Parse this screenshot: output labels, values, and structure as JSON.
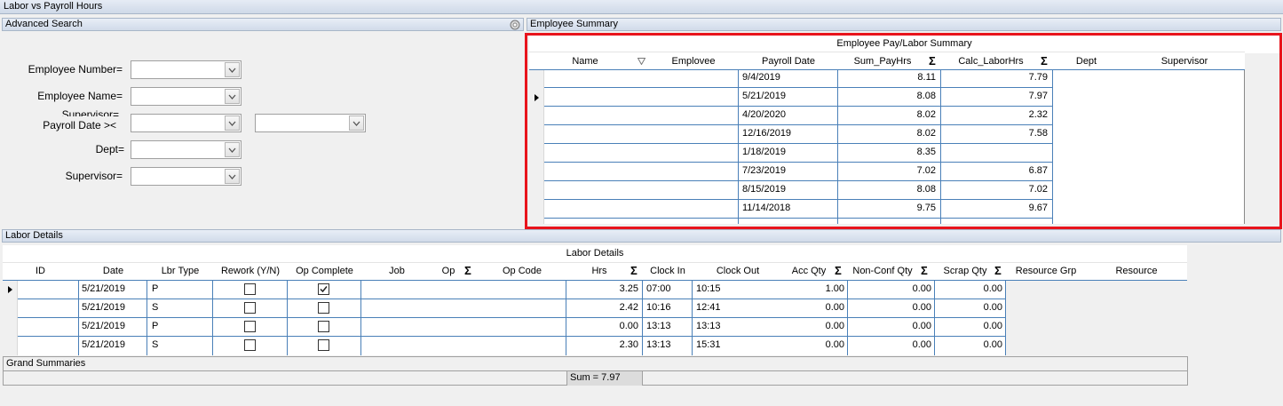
{
  "window": {
    "title": "Labor vs Payroll Hours"
  },
  "search_panel": {
    "title": "Advanced Search",
    "fields": [
      {
        "label": "Employee Number=",
        "value": ""
      },
      {
        "label": "Employee Name=",
        "value": ""
      },
      {
        "label_top": "Supervisor=",
        "label": "Payroll Date ><",
        "value": "",
        "value2": ""
      },
      {
        "label": "Dept=",
        "value": ""
      },
      {
        "label": "Supervisor=",
        "value": ""
      }
    ]
  },
  "employee_summary": {
    "panel_title": "Employee Summary",
    "grid_title": "Employee Pay/Labor Summary",
    "columns": [
      "Name",
      "Emplovee",
      "Payroll Date",
      "Sum_PayHrs",
      "Calc_LaborHrs",
      "Dept",
      "Supervisor"
    ],
    "rows": [
      {
        "date": "9/4/2019",
        "pay": "8.11",
        "labor": "7.79"
      },
      {
        "date": "5/21/2019",
        "pay": "8.08",
        "labor": "7.97"
      },
      {
        "date": "4/20/2020",
        "pay": "8.02",
        "labor": "2.32"
      },
      {
        "date": "12/16/2019",
        "pay": "8.02",
        "labor": "7.58"
      },
      {
        "date": "1/18/2019",
        "pay": "8.35",
        "labor": ""
      },
      {
        "date": "7/23/2019",
        "pay": "7.02",
        "labor": "6.87"
      },
      {
        "date": "8/15/2019",
        "pay": "8.08",
        "labor": "7.02"
      },
      {
        "date": "11/14/2018",
        "pay": "9.75",
        "labor": "9.67"
      }
    ],
    "highlight_color": "#e8141c"
  },
  "labor_details": {
    "panel_title": "Labor Details",
    "grid_title": "Labor Details",
    "columns": [
      "ID",
      "Date",
      "Lbr Type",
      "Rework (Y/N)",
      "Op Complete",
      "Job",
      "Op",
      "Op Code",
      "Hrs",
      "Clock In",
      "Clock Out",
      "Acc Qty",
      "Non-Conf Qty",
      "Scrap Qty",
      "Resource Grp",
      "Resource"
    ],
    "rows": [
      {
        "date": "5/21/2019",
        "type": "P",
        "rework": false,
        "complete": true,
        "hrs": "3.25",
        "in": "07:00",
        "out": "10:15",
        "acc": "1.00",
        "nonconf": "0.00",
        "scrap": "0.00"
      },
      {
        "date": "5/21/2019",
        "type": "S",
        "rework": false,
        "complete": false,
        "hrs": "2.42",
        "in": "10:16",
        "out": "12:41",
        "acc": "0.00",
        "nonconf": "0.00",
        "scrap": "0.00"
      },
      {
        "date": "5/21/2019",
        "type": "P",
        "rework": false,
        "complete": false,
        "hrs": "0.00",
        "in": "13:13",
        "out": "13:13",
        "acc": "0.00",
        "nonconf": "0.00",
        "scrap": "0.00"
      },
      {
        "date": "5/21/2019",
        "type": "S",
        "rework": false,
        "complete": false,
        "hrs": "2.30",
        "in": "13:13",
        "out": "15:31",
        "acc": "0.00",
        "nonconf": "0.00",
        "scrap": "0.00"
      }
    ],
    "grand_summaries_label": "Grand Summaries",
    "sum_label": "Sum = 7.97"
  }
}
